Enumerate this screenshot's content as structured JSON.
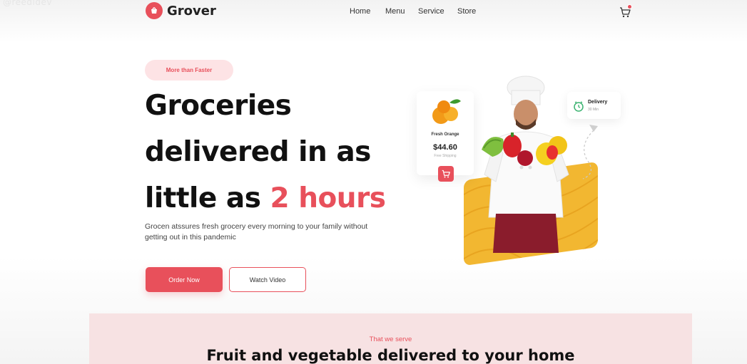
{
  "watermark": "@reedidev",
  "header": {
    "brand": "Grover",
    "nav": [
      "Home",
      "Menu",
      "Service",
      "Store"
    ],
    "cart_icon": "cart-icon"
  },
  "hero": {
    "badge": "More than Faster",
    "headline_line1": "Groceries",
    "headline_line2": "delivered in as",
    "headline_line3_prefix": "little as ",
    "headline_line3_accent": "2 hours",
    "subtext": "Grocen atssures fresh grocery every morning to your family without getting out in this pandemic",
    "primary_button": "Order Now",
    "secondary_button": "Watch Video"
  },
  "product_card": {
    "name": "Fresh Orange",
    "price": "$44.60",
    "shipping": "Free Shipping"
  },
  "delivery_card": {
    "title": "Delivery",
    "time": "30 Min"
  },
  "serve": {
    "kicker": "That we serve",
    "title": "Fruit and vegetable delivered to your home"
  },
  "colors": {
    "accent": "#e8505b",
    "accent_light": "#fde3e5",
    "card_yellow": "#f2b731",
    "section_bg": "#f7e2e3"
  }
}
